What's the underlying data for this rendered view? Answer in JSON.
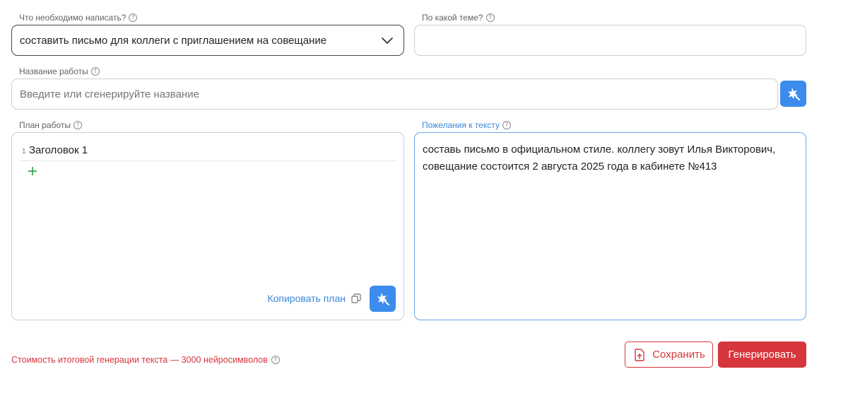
{
  "form": {
    "what_label": "Что необходимо написать?",
    "what_value": "составить письмо для коллеги с приглашением на совещание",
    "topic_label": "По какой теме?",
    "topic_value": "",
    "title_label": "Название работы",
    "title_placeholder": "Введите или сгенерируйте название",
    "plan_label": "План работы",
    "plan_items": [
      {
        "num": "1",
        "title": "Заголовок 1"
      }
    ],
    "copy_plan_label": "Копировать план",
    "wishes_label": "Пожелания к тексту",
    "wishes_value": "составь письмо в официальном стиле. коллегу зовут Илья Викторович, совещание состоится 2 августа 2025 года в кабинете №413"
  },
  "footer": {
    "cost_text": "Стоимость итоговой генерации текста — 3000 нейросимволов",
    "save_label": "Сохранить",
    "generate_label": "Генерировать"
  },
  "icons": {
    "help": "question-circle-icon",
    "chevron": "chevron-down-icon",
    "magic": "magic-wand-icon",
    "plus": "plus-icon",
    "copy": "copy-icon",
    "save": "file-upload-icon"
  },
  "colors": {
    "accent_blue": "#3b8ced",
    "accent_red": "#d6363c",
    "add_green": "#2e9b3e"
  }
}
